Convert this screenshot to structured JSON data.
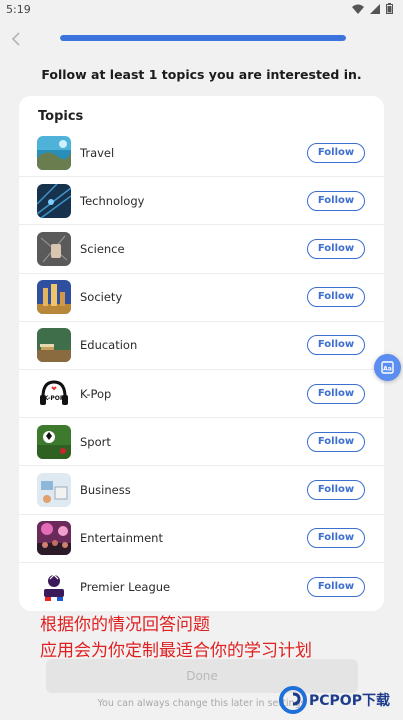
{
  "status": {
    "time": "5:19"
  },
  "header": {
    "progress_fraction": 1.0,
    "prompt": "Follow at least 1 topics you are interested in."
  },
  "card": {
    "title": "Topics"
  },
  "topics": [
    {
      "name": "Travel",
      "button": "Follow"
    },
    {
      "name": "Technology",
      "button": "Follow"
    },
    {
      "name": "Science",
      "button": "Follow"
    },
    {
      "name": "Society",
      "button": "Follow"
    },
    {
      "name": "Education",
      "button": "Follow"
    },
    {
      "name": "K-Pop",
      "button": "Follow"
    },
    {
      "name": "Sport",
      "button": "Follow"
    },
    {
      "name": "Business",
      "button": "Follow"
    },
    {
      "name": "Entertainment",
      "button": "Follow"
    },
    {
      "name": "Premier League",
      "button": "Follow"
    }
  ],
  "overlay": {
    "line1": "根据你的情况回答问题",
    "line2": "应用会为你定制最适合你的学习计划"
  },
  "footer": {
    "done_label": "Done",
    "note": "You can always change this later in settings"
  },
  "watermark": {
    "text": "PCPOP下载"
  },
  "colors": {
    "accent": "#3d6fcf",
    "progress": "#3d73dc",
    "overlay_text": "#e02020"
  }
}
